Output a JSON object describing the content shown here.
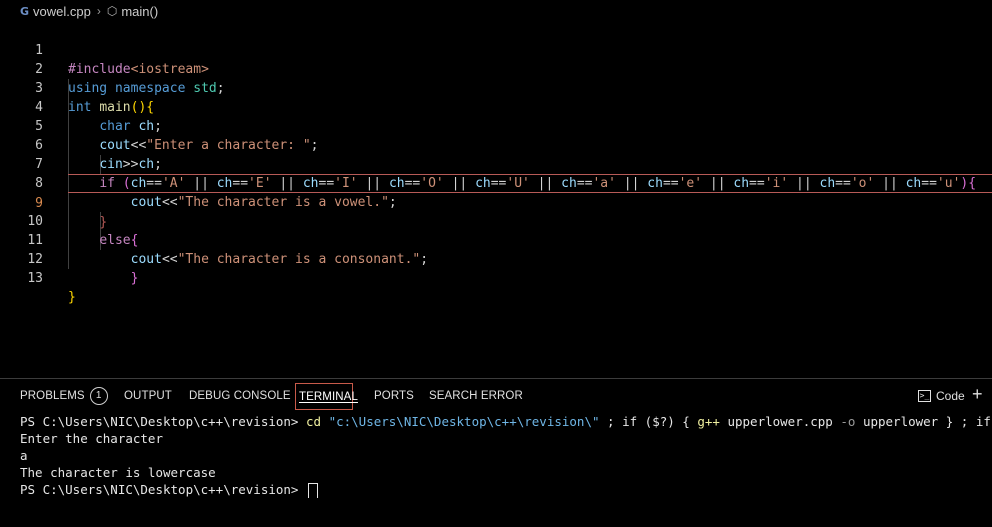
{
  "breadcrumb": {
    "file_icon": "C++ file icon",
    "file": "vowel.cpp",
    "separator": "›",
    "symbol_icon": "cube symbol icon",
    "symbol": "main()"
  },
  "editor": {
    "current_line": 9,
    "lines": [
      {
        "n": "1",
        "text": "#include<iostream>"
      },
      {
        "n": "2",
        "text": "using namespace std;"
      },
      {
        "n": "3",
        "text": "int main(){"
      },
      {
        "n": "4",
        "text": "    char ch;"
      },
      {
        "n": "5",
        "text": "    cout<<\"Enter a character: \";"
      },
      {
        "n": "6",
        "text": "    cin>>ch;"
      },
      {
        "n": "7",
        "text": "    if (ch=='A' || ch=='E' || ch=='I' || ch=='O' || ch=='U' || ch=='a' || ch=='e' || ch=='i' || ch=='o' || ch=='u'){"
      },
      {
        "n": "8",
        "text": "        cout<<\"The character is a vowel.\";"
      },
      {
        "n": "9",
        "text": "    }"
      },
      {
        "n": "10",
        "text": "    else{"
      },
      {
        "n": "11",
        "text": "        cout<<\"The character is a consonant.\";"
      },
      {
        "n": "12",
        "text": "        }"
      },
      {
        "n": "13",
        "text": "}"
      }
    ]
  },
  "panel": {
    "tabs": [
      {
        "id": "problems",
        "label": "PROBLEMS",
        "badge": "1"
      },
      {
        "id": "output",
        "label": "OUTPUT"
      },
      {
        "id": "debug",
        "label": "DEBUG CONSOLE"
      },
      {
        "id": "terminal",
        "label": "TERMINAL",
        "active": true
      },
      {
        "id": "ports",
        "label": "PORTS"
      },
      {
        "id": "search",
        "label": "SEARCH ERROR"
      }
    ],
    "terminal_button_label": "Code",
    "terminal_icon": "terminal icon",
    "add_icon": "plus icon"
  },
  "terminal": {
    "prompt1": "PS C:\\Users\\NIC\\Desktop\\c++\\revision> ",
    "cmd_cd": "cd",
    "cmd_path": "\"c:\\Users\\NIC\\Desktop\\c++\\revision\\\"",
    "cmd_rest1": " ; if ($?) { ",
    "cmd_gpp": "g++",
    "cmd_file": " upperlower.cpp ",
    "cmd_flag": "-o",
    "cmd_out": " upperlower } ; if ($?) { .\\",
    "out1": "Enter the character",
    "out2": "a",
    "out3": "The character is lowercase",
    "prompt2": "PS C:\\Users\\NIC\\Desktop\\c++\\revision> "
  },
  "colors": {
    "background": "#000000",
    "accent_border": "#c85a4a",
    "current_line_border": "#b75a57"
  }
}
